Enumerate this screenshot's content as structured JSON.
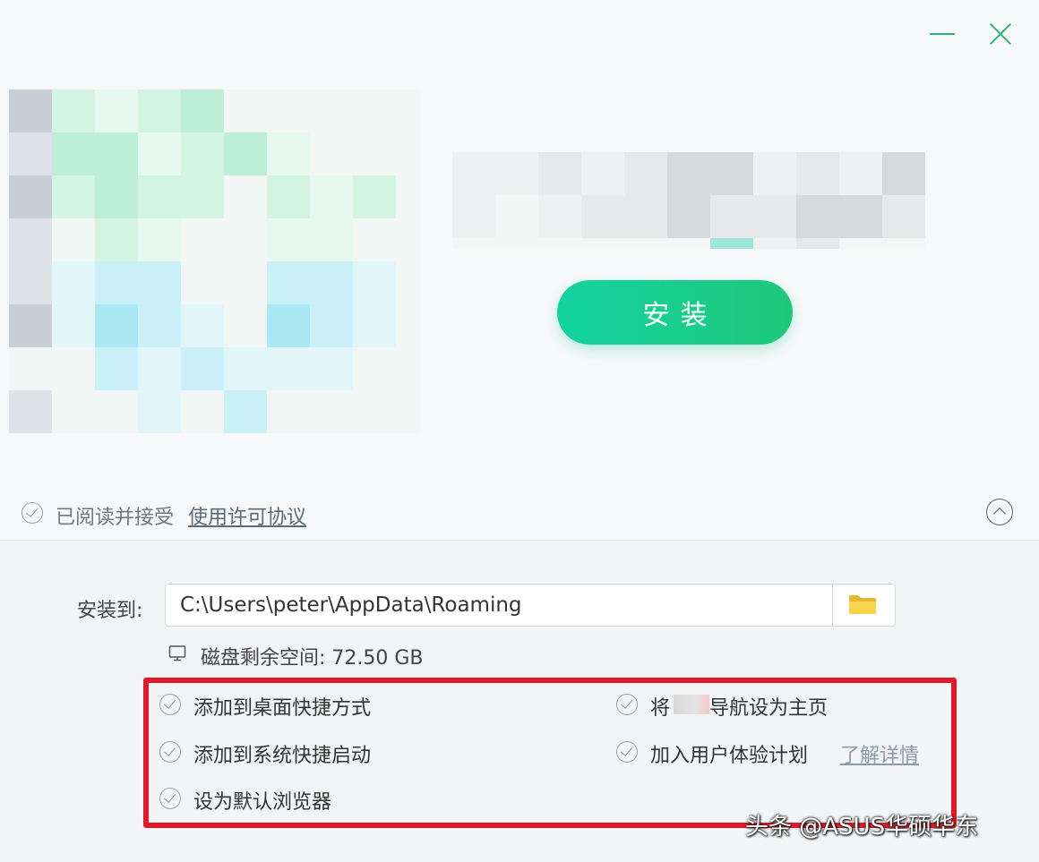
{
  "window": {
    "minimize_icon": "minimize-icon",
    "close_icon": "close-icon",
    "accent_color": "#2ab87a"
  },
  "install_button": {
    "label": "安装"
  },
  "agreement": {
    "text": "已阅读并接受",
    "link": "使用许可协议"
  },
  "install_path": {
    "label": "安装到:",
    "value": "C:\\Users\\peter\\AppData\\Roaming",
    "folder_icon": "folder-icon"
  },
  "disk": {
    "text": "磁盘剩余空间: 72.50 GB",
    "icon": "monitor-icon"
  },
  "options": {
    "left": [
      {
        "label": "添加到桌面快捷方式"
      },
      {
        "label": "添加到系统快捷启动"
      },
      {
        "label": "设为默认浏览器"
      }
    ],
    "right": [
      {
        "label_prefix": "将",
        "label_suffix": "导航设为主页"
      },
      {
        "label": "加入用户体验计划",
        "link": "了解详情"
      }
    ]
  },
  "highlight_color": "#e3192b",
  "watermark": "头条 @ASUS华硕华东"
}
